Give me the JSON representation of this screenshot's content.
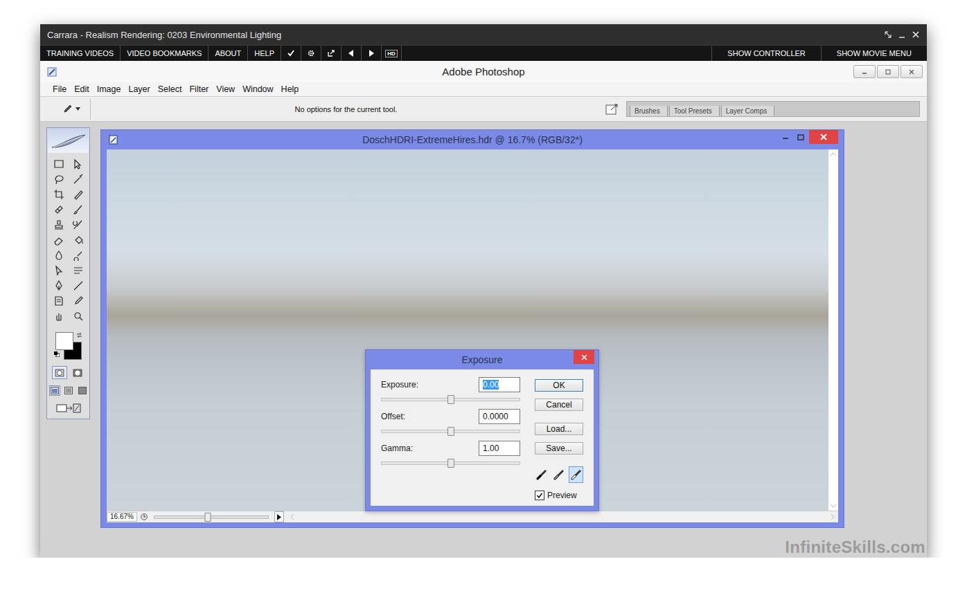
{
  "player": {
    "title": "Carrara - Realism Rendering: 0203 Environmental Lighting",
    "menu": [
      "TRAINING VIDEOS",
      "VIDEO BOOKMARKS",
      "ABOUT",
      "HELP"
    ],
    "hd_label": "HD",
    "right_menu": [
      "SHOW CONTROLLER",
      "SHOW MOVIE MENU"
    ],
    "watermark": "InfiniteSkills.com"
  },
  "photoshop": {
    "title": "Adobe Photoshop",
    "menu": [
      "File",
      "Edit",
      "Image",
      "Layer",
      "Select",
      "Filter",
      "View",
      "Window",
      "Help"
    ],
    "options_text": "No options for the current tool.",
    "palette_tabs": [
      "Brushes",
      "Tool Presets",
      "Layer Comps"
    ]
  },
  "document": {
    "title": "DoschHDRI-ExtremeHires.hdr @ 16.7% (RGB/32*)",
    "zoom": "16.67%",
    "nav_level": 0.47
  },
  "dialog": {
    "title": "Exposure",
    "fields": [
      {
        "label": "Exposure:",
        "value": "0.00",
        "selected": true,
        "level": 0.5
      },
      {
        "label": "Offset:",
        "value": "0.0000",
        "selected": false,
        "level": 0.5
      },
      {
        "label": "Gamma:",
        "value": "1.00",
        "selected": false,
        "level": 0.5
      }
    ],
    "buttons": [
      "OK",
      "Cancel",
      "Load...",
      "Save..."
    ],
    "droppers": [
      {
        "selected": false,
        "color": "#000000"
      },
      {
        "selected": false,
        "color": "#808080"
      },
      {
        "selected": true,
        "color": "#ffffff"
      }
    ],
    "preview": {
      "label": "Preview",
      "checked": true
    }
  }
}
